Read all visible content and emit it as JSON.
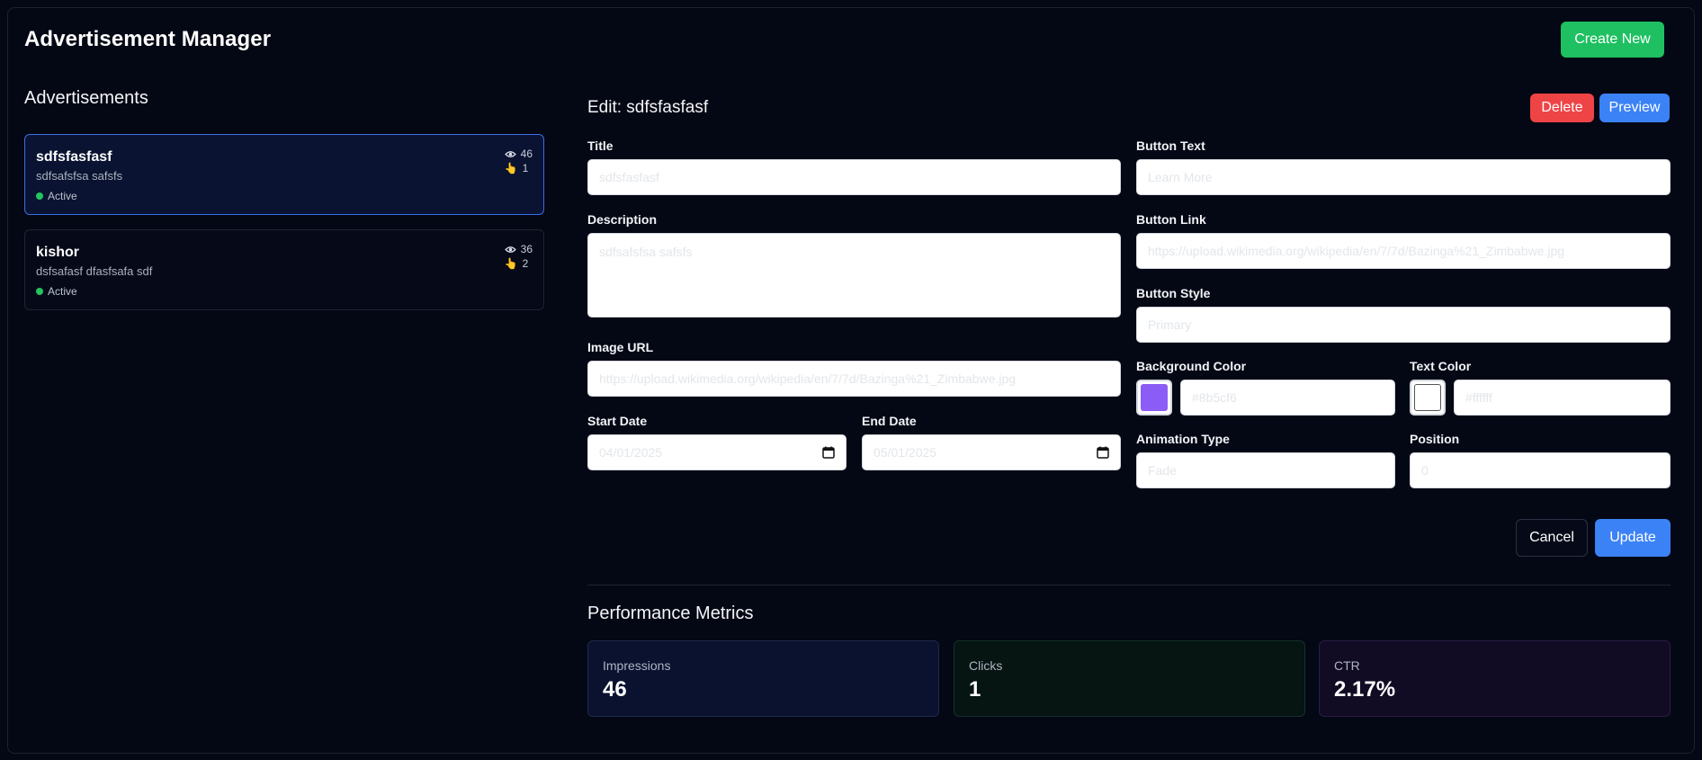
{
  "app": {
    "title": "Advertisement Manager",
    "create_button": "Create New"
  },
  "sidebar": {
    "title": "Advertisements",
    "ads": [
      {
        "name": "sdfsfasfasf",
        "description": "sdfsafsfsa safsfs",
        "status": "Active",
        "impressions": "46",
        "clicks": "1",
        "selected": true
      },
      {
        "name": "kishor",
        "description": "dsfsafasf dfasfsafa sdf",
        "status": "Active",
        "impressions": "36",
        "clicks": "2",
        "selected": false
      }
    ]
  },
  "editor": {
    "heading": "Edit: sdfsfasfasf",
    "delete_button": "Delete",
    "preview_button": "Preview",
    "fields": {
      "title": {
        "label": "Title",
        "value": "sdfsfasfasf"
      },
      "button_text": {
        "label": "Button Text",
        "value": "Learn More"
      },
      "description": {
        "label": "Description",
        "value": "sdfsafsfsa safsfs"
      },
      "button_link": {
        "label": "Button Link",
        "value": "https://upload.wikimedia.org/wikipedia/en/7/7d/Bazinga%21_Zimbabwe.jpg"
      },
      "button_style": {
        "label": "Button Style",
        "value": "Primary"
      },
      "image_url": {
        "label": "Image URL",
        "value": "https://upload.wikimedia.org/wikipedia/en/7/7d/Bazinga%21_Zimbabwe.jpg"
      },
      "background_color": {
        "label": "Background Color",
        "value": "#8b5cf6",
        "swatch": "#8b5cf6"
      },
      "text_color": {
        "label": "Text Color",
        "value": "#ffffff",
        "swatch": "#ffffff"
      },
      "start_date": {
        "label": "Start Date",
        "value": "04/01/2025"
      },
      "end_date": {
        "label": "End Date",
        "value": "05/01/2025"
      },
      "animation_type": {
        "label": "Animation Type",
        "value": "Fade"
      },
      "position": {
        "label": "Position",
        "value": "0"
      }
    },
    "cancel_button": "Cancel",
    "update_button": "Update"
  },
  "metrics": {
    "title": "Performance Metrics",
    "items": [
      {
        "label": "Impressions",
        "value": "46"
      },
      {
        "label": "Clicks",
        "value": "1"
      },
      {
        "label": "CTR",
        "value": "2.17%"
      }
    ]
  },
  "colors": {
    "background": "#040714",
    "accent_blue": "#3b82f6",
    "create_green": "#1ec061",
    "delete_red": "#ee4446",
    "active_dot": "#22c55e"
  }
}
